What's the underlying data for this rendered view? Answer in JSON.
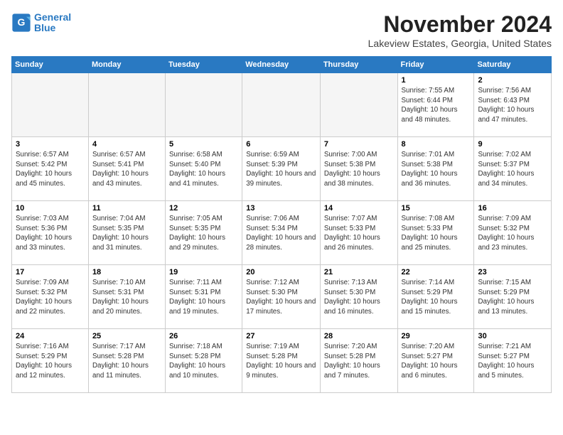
{
  "header": {
    "logo_line1": "General",
    "logo_line2": "Blue",
    "month_title": "November 2024",
    "location": "Lakeview Estates, Georgia, United States"
  },
  "days_of_week": [
    "Sunday",
    "Monday",
    "Tuesday",
    "Wednesday",
    "Thursday",
    "Friday",
    "Saturday"
  ],
  "weeks": [
    [
      {
        "day": "",
        "info": ""
      },
      {
        "day": "",
        "info": ""
      },
      {
        "day": "",
        "info": ""
      },
      {
        "day": "",
        "info": ""
      },
      {
        "day": "",
        "info": ""
      },
      {
        "day": "1",
        "info": "Sunrise: 7:55 AM\nSunset: 6:44 PM\nDaylight: 10 hours and 48 minutes."
      },
      {
        "day": "2",
        "info": "Sunrise: 7:56 AM\nSunset: 6:43 PM\nDaylight: 10 hours and 47 minutes."
      }
    ],
    [
      {
        "day": "3",
        "info": "Sunrise: 6:57 AM\nSunset: 5:42 PM\nDaylight: 10 hours and 45 minutes."
      },
      {
        "day": "4",
        "info": "Sunrise: 6:57 AM\nSunset: 5:41 PM\nDaylight: 10 hours and 43 minutes."
      },
      {
        "day": "5",
        "info": "Sunrise: 6:58 AM\nSunset: 5:40 PM\nDaylight: 10 hours and 41 minutes."
      },
      {
        "day": "6",
        "info": "Sunrise: 6:59 AM\nSunset: 5:39 PM\nDaylight: 10 hours and 39 minutes."
      },
      {
        "day": "7",
        "info": "Sunrise: 7:00 AM\nSunset: 5:38 PM\nDaylight: 10 hours and 38 minutes."
      },
      {
        "day": "8",
        "info": "Sunrise: 7:01 AM\nSunset: 5:38 PM\nDaylight: 10 hours and 36 minutes."
      },
      {
        "day": "9",
        "info": "Sunrise: 7:02 AM\nSunset: 5:37 PM\nDaylight: 10 hours and 34 minutes."
      }
    ],
    [
      {
        "day": "10",
        "info": "Sunrise: 7:03 AM\nSunset: 5:36 PM\nDaylight: 10 hours and 33 minutes."
      },
      {
        "day": "11",
        "info": "Sunrise: 7:04 AM\nSunset: 5:35 PM\nDaylight: 10 hours and 31 minutes."
      },
      {
        "day": "12",
        "info": "Sunrise: 7:05 AM\nSunset: 5:35 PM\nDaylight: 10 hours and 29 minutes."
      },
      {
        "day": "13",
        "info": "Sunrise: 7:06 AM\nSunset: 5:34 PM\nDaylight: 10 hours and 28 minutes."
      },
      {
        "day": "14",
        "info": "Sunrise: 7:07 AM\nSunset: 5:33 PM\nDaylight: 10 hours and 26 minutes."
      },
      {
        "day": "15",
        "info": "Sunrise: 7:08 AM\nSunset: 5:33 PM\nDaylight: 10 hours and 25 minutes."
      },
      {
        "day": "16",
        "info": "Sunrise: 7:09 AM\nSunset: 5:32 PM\nDaylight: 10 hours and 23 minutes."
      }
    ],
    [
      {
        "day": "17",
        "info": "Sunrise: 7:09 AM\nSunset: 5:32 PM\nDaylight: 10 hours and 22 minutes."
      },
      {
        "day": "18",
        "info": "Sunrise: 7:10 AM\nSunset: 5:31 PM\nDaylight: 10 hours and 20 minutes."
      },
      {
        "day": "19",
        "info": "Sunrise: 7:11 AM\nSunset: 5:31 PM\nDaylight: 10 hours and 19 minutes."
      },
      {
        "day": "20",
        "info": "Sunrise: 7:12 AM\nSunset: 5:30 PM\nDaylight: 10 hours and 17 minutes."
      },
      {
        "day": "21",
        "info": "Sunrise: 7:13 AM\nSunset: 5:30 PM\nDaylight: 10 hours and 16 minutes."
      },
      {
        "day": "22",
        "info": "Sunrise: 7:14 AM\nSunset: 5:29 PM\nDaylight: 10 hours and 15 minutes."
      },
      {
        "day": "23",
        "info": "Sunrise: 7:15 AM\nSunset: 5:29 PM\nDaylight: 10 hours and 13 minutes."
      }
    ],
    [
      {
        "day": "24",
        "info": "Sunrise: 7:16 AM\nSunset: 5:29 PM\nDaylight: 10 hours and 12 minutes."
      },
      {
        "day": "25",
        "info": "Sunrise: 7:17 AM\nSunset: 5:28 PM\nDaylight: 10 hours and 11 minutes."
      },
      {
        "day": "26",
        "info": "Sunrise: 7:18 AM\nSunset: 5:28 PM\nDaylight: 10 hours and 10 minutes."
      },
      {
        "day": "27",
        "info": "Sunrise: 7:19 AM\nSunset: 5:28 PM\nDaylight: 10 hours and 9 minutes."
      },
      {
        "day": "28",
        "info": "Sunrise: 7:20 AM\nSunset: 5:28 PM\nDaylight: 10 hours and 7 minutes."
      },
      {
        "day": "29",
        "info": "Sunrise: 7:20 AM\nSunset: 5:27 PM\nDaylight: 10 hours and 6 minutes."
      },
      {
        "day": "30",
        "info": "Sunrise: 7:21 AM\nSunset: 5:27 PM\nDaylight: 10 hours and 5 minutes."
      }
    ]
  ]
}
